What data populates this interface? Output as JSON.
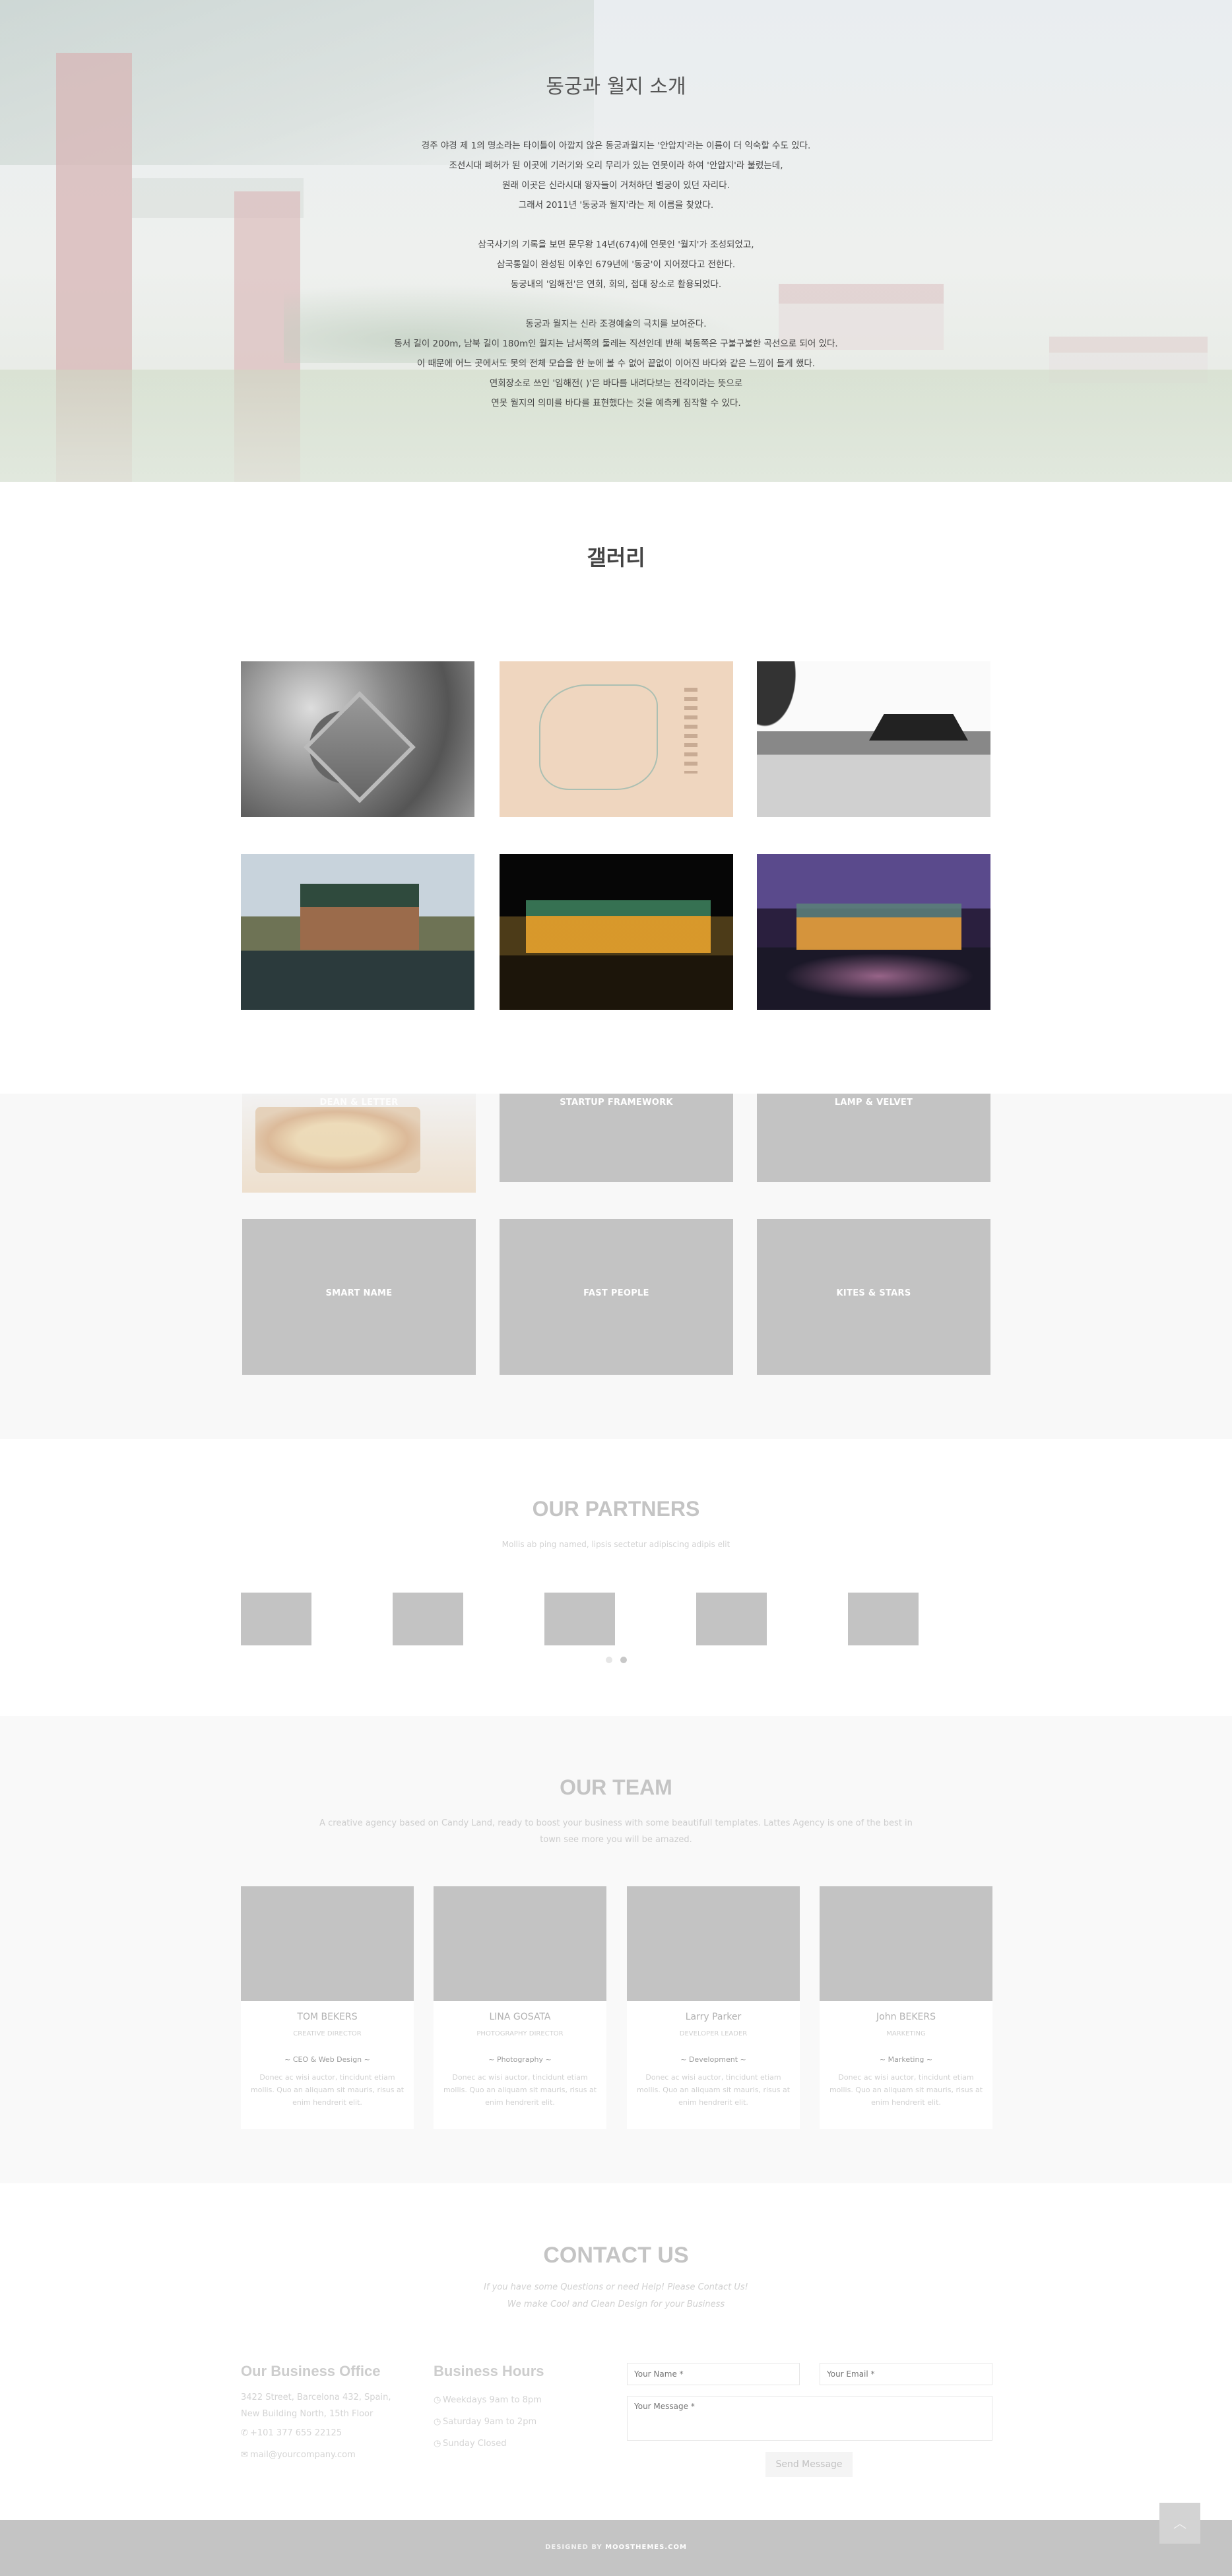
{
  "hero": {
    "title": "동궁과 월지 소개",
    "paragraphs": [
      [
        "경주 야경 제 1의 명소라는 타이틀이 아깝지 않은 동궁과월지는 '안압지'라는 이름이 더 익숙할 수도 있다.",
        "조선시대 폐허가 된 이곳에 기러기와 오리 무리가 있는 연못이라 하여 '안압지'라 불렸는데,",
        "원래 이곳은 신라시대 왕자들이 거처하던 별궁이 있던 자리다.",
        "그래서 2011년 '동궁과 월지'라는 제 이름을 찾았다."
      ],
      [
        "삼국사기의 기록을 보면 문무왕 14년(674)에 연못인 '월지'가 조성되었고,",
        "삼국통일이 완성된 이후인 679년에 '동궁'이 지어졌다고 전한다.",
        "동궁내의 '임해전'은 연회, 회의, 접대 장소로 활용되었다."
      ],
      [
        "동궁과 월지는 신라 조경예술의 극치를 보여준다.",
        "동서 길이 200m, 남북 길이 180m인 월지는 남서쪽의 둘레는 직선인데 반해 북동쪽은 구불구불한 곡선으로 되어 있다.",
        "이 때문에 어느 곳에서도 못의 전체 모습을 한 눈에 볼 수 없어 끝없이 이어진 바다와 같은 느낌이 들게 했다.",
        "연회장소로 쓰인 '임해전( )'은 바다를 내려다보는 전각이라는 뜻으로",
        "연못 월지의 의미를 바다를 표현했다는 것을 예측케 짐작할 수 있다."
      ]
    ]
  },
  "gallery": {
    "title": "갤러리"
  },
  "portfolio": {
    "tiles": [
      "DEAN & LETTER",
      "STARTUP FRAMEWORK",
      "LAMP & VELVET",
      "SMART NAME",
      "FAST PEOPLE",
      "KITES & STARS"
    ]
  },
  "partners": {
    "title": "OUR PARTNERS",
    "subtitle": "Mollis ab ping named, lipsis sectetur adipiscing adipis elit"
  },
  "team": {
    "title": "OUR TEAM",
    "intro_line1": "A creative agency based on Candy Land, ready to boost your business with some beautifull templates. Lattes Agency is one of the best in",
    "intro_line2": "town see more you will be amazed.",
    "members": [
      {
        "name": "TOM BEKERS",
        "role": "CREATIVE DIRECTOR",
        "dept": "~ CEO & Web Design ~",
        "desc": "Donec ac wisi auctor, tincidunt etiam mollis. Quo an aliquam sit mauris, risus at enim hendrerit elit."
      },
      {
        "name": "LINA GOSATA",
        "role": "PHOTOGRAPHY DIRECTOR",
        "dept": "~ Photography ~",
        "desc": "Donec ac wisi auctor, tincidunt etiam mollis. Quo an aliquam sit mauris, risus at enim hendrerit elit."
      },
      {
        "name": "Larry Parker",
        "role": "DEVELOPER LEADER",
        "dept": "~ Development ~",
        "desc": "Donec ac wisi auctor, tincidunt etiam mollis. Quo an aliquam sit mauris, risus at enim hendrerit elit."
      },
      {
        "name": "John BEKERS",
        "role": "MARKETING",
        "dept": "~ Marketing ~",
        "desc": "Donec ac wisi auctor, tincidunt etiam mollis. Quo an aliquam sit mauris, risus at enim hendrerit elit."
      }
    ]
  },
  "contact": {
    "title": "CONTACT US",
    "sub1": "If you have some Questions or need Help! Please Contact Us!",
    "sub2": "We make Cool and Clean Design for your Business",
    "office_title": "Our Business Office",
    "office_address1": "3422 Street, Barcelona 432, Spain,",
    "office_address2": "New Building North, 15th Floor",
    "office_phone": "+101 377 655 22125",
    "office_email": "mail@yourcompany.com",
    "hours_title": "Business Hours",
    "hours": [
      "Weekdays 9am to 8pm",
      "Saturday 9am to 2pm",
      "Sunday Closed"
    ],
    "name_placeholder": "Your Name *",
    "email_placeholder": "Your Email *",
    "message_placeholder": "Your Message *",
    "send_label": "Send Message"
  },
  "footer": {
    "prefix": "DESIGNED BY",
    "brand": "MOOSTHEMES.COM",
    "to_top": "︿"
  },
  "icons": {
    "phone": "phone-icon",
    "email": "envelope-icon",
    "clock": "clock-icon",
    "to_top": "chevron-up-icon"
  }
}
